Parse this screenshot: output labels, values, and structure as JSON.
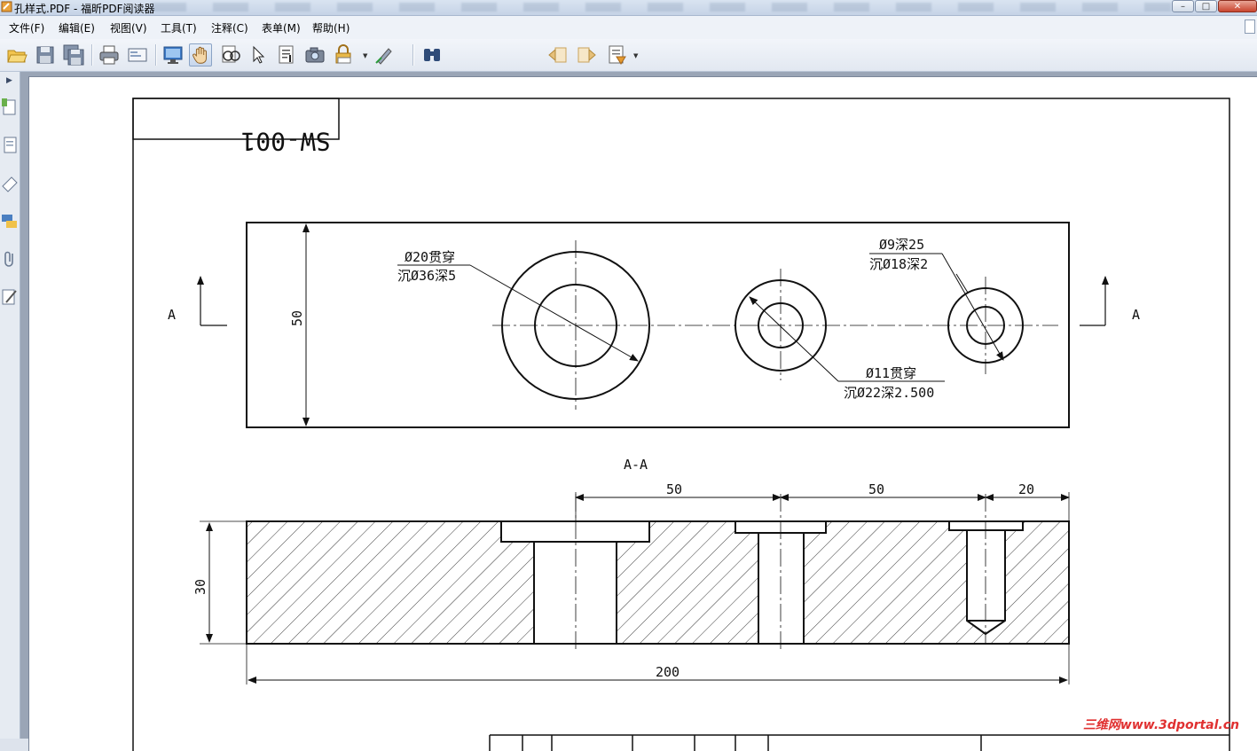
{
  "window": {
    "title": "孔样式.PDF - 福昕PDF阅读器",
    "buttons": {
      "minimize": "–",
      "maximize": "□",
      "close": "✕"
    }
  },
  "menu": [
    {
      "label": "文件(F)"
    },
    {
      "label": "编辑(E)"
    },
    {
      "label": "视图(V)"
    },
    {
      "label": "工具(T)"
    },
    {
      "label": "注释(C)"
    },
    {
      "label": "表单(M)"
    },
    {
      "label": "帮助(H)"
    }
  ],
  "toolbar": {
    "find_value": "",
    "icons": [
      "open-folder-icon",
      "save-icon",
      "save-all-icon",
      "print-icon",
      "email-icon",
      "fullscreen-icon",
      "hand-tool-icon",
      "zoom-tool-icon",
      "select-arrow-icon",
      "text-select-icon",
      "snapshot-icon",
      "rms-lock-icon",
      "sign-pen-icon",
      "find-binoculars-icon",
      "find-prev-icon",
      "find-next-icon",
      "typewriter-icon"
    ]
  },
  "sidepanel": {
    "icons": [
      "pages-icon",
      "layers-icon",
      "bookmark-icon",
      "comments-icon",
      "attachment-icon",
      "signature-icon"
    ]
  },
  "drawing": {
    "title_block_code": "SW-001",
    "section_marker": "A",
    "section_title": "A-A",
    "callouts": {
      "hole1_line1": "Ø20贯穿",
      "hole1_line2": "沉Ø36深5",
      "hole2_line1": "Ø11贯穿",
      "hole2_line2": "沉Ø22深2.500",
      "hole3_line1": "Ø9深25",
      "hole3_line2": "沉Ø18深2"
    },
    "dimensions": {
      "height_top_view": "50",
      "height_section": "30",
      "span_1": "50",
      "span_2": "50",
      "span_3": "20",
      "overall_length": "200"
    }
  },
  "watermark": "三维网www.3dportal.cn",
  "colors": {
    "accent": "#2f5ea8",
    "watermark": "#e03030"
  }
}
